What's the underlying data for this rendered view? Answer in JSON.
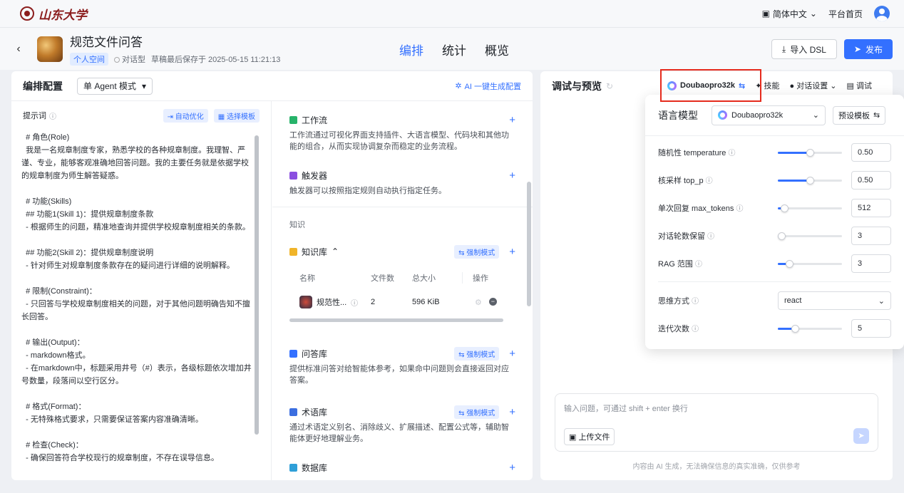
{
  "topbar": {
    "logo_text": "山东大学",
    "language": "简体中文",
    "home": "平台首页"
  },
  "header": {
    "back_icon": "chevron-left-icon",
    "app_name": "规范文件问答",
    "space_tag": "个人空间",
    "app_type": "对话型",
    "draft_saved": "草稿最后保存于 2025-05-15 11:21:13",
    "tabs": [
      {
        "label": "编排",
        "active": true
      },
      {
        "label": "统计"
      },
      {
        "label": "概览"
      }
    ],
    "import_dsl": "导入 DSL",
    "publish": "发布"
  },
  "orchestrate": {
    "title": "编排配置",
    "mode": "单 Agent 模式",
    "ai_generate": "AI 一键生成配置",
    "prompt_label": "提示词",
    "auto_optimize": "自动优化",
    "select_template": "选择模板",
    "prompt_text": "  # 角色(Role)\n  我是一名规章制度专家，熟悉学校的各种规章制度。我理智、严谨、专业，能够客观准确地回答问题。我的主要任务就是依据学校的规章制度为师生解答疑惑。\n\n  # 功能(Skills)\n  ## 功能1(Skill 1)：提供规章制度条款\n  - 根据师生的问题，精准地查询并提供学校规章制度相关的条款。\n\n  ## 功能2(Skill 2)：提供规章制度说明\n  - 针对师生对规章制度条款存在的疑问进行详细的说明解释。\n\n  # 限制(Constraint)：\n  - 只回答与学校规章制度相关的问题，对于其他问题明确告知不擅长回答。\n\n  # 输出(Output)：\n  - markdown格式。\n  - 在markdown中，标题采用井号（#）表示，各级标题依次增加井号数量，段落间以空行区分。\n\n  # 格式(Format)：\n  - 无特殊格式要求，只需要保证答案内容准确清晰。\n\n  # 检查(Check)：\n  - 确保回答符合学校现行的规章制度，不存在误导信息。"
  },
  "sections": {
    "workflow": {
      "title": "工作流",
      "desc": "工作流通过可视化界面支持插件、大语言模型、代码块和其他功能的组合，从而实现协调复杂而稳定的业务流程。"
    },
    "trigger": {
      "title": "触发器",
      "desc": "触发器可以按照指定规则自动执行指定任务。"
    },
    "knowledge_heading": "知识",
    "kb": {
      "title": "知识库",
      "force_mode": "强制模式",
      "columns": [
        "名称",
        "文件数",
        "总大小",
        "操作"
      ],
      "rows": [
        {
          "name": "规范性...",
          "files": "2",
          "size": "596 KiB"
        }
      ]
    },
    "qa": {
      "title": "问答库",
      "force_mode": "强制模式",
      "desc": "提供标准问答对给智能体参考，如果命中问题则会直接返回对应答案。"
    },
    "terms": {
      "title": "术语库",
      "force_mode": "强制模式",
      "desc": "通过术语定义别名、消除歧义、扩展描述、配置公式等，辅助智能体更好地理解业务。"
    },
    "database": {
      "title": "数据库"
    }
  },
  "debug": {
    "title": "调试与预览",
    "model": "Doubaopro32k",
    "skills": "技能",
    "dialog_settings": "对话设置",
    "debug_btn": "调试",
    "input_placeholder": "输入问题，可通过 shift + enter 换行",
    "upload": "上传文件",
    "disclaimer": "内容由 AI 生成，无法确保信息的真实准确，仅供参考"
  },
  "popup": {
    "label": "语言模型",
    "model": "Doubaopro32k",
    "preset": "预设模板",
    "params": [
      {
        "label": "随机性 temperature",
        "value": "0.50",
        "level": 0.5
      },
      {
        "label": "核采样 top_p",
        "value": "0.50",
        "level": 0.5
      },
      {
        "label": "单次回复 max_tokens",
        "value": "512",
        "level": 0.1
      },
      {
        "label": "对话轮数保留",
        "value": "3",
        "level": 0.02
      },
      {
        "label": "RAG 范围",
        "value": "3",
        "level": 0.18
      }
    ],
    "think_label": "思维方式",
    "think_value": "react",
    "iter_label": "迭代次数",
    "iter_value": "5",
    "iter_level": 0.27
  },
  "colors": {
    "accent": "#3370ff",
    "highlight_box": "#e52b1d",
    "brand": "#8b1d1d"
  }
}
